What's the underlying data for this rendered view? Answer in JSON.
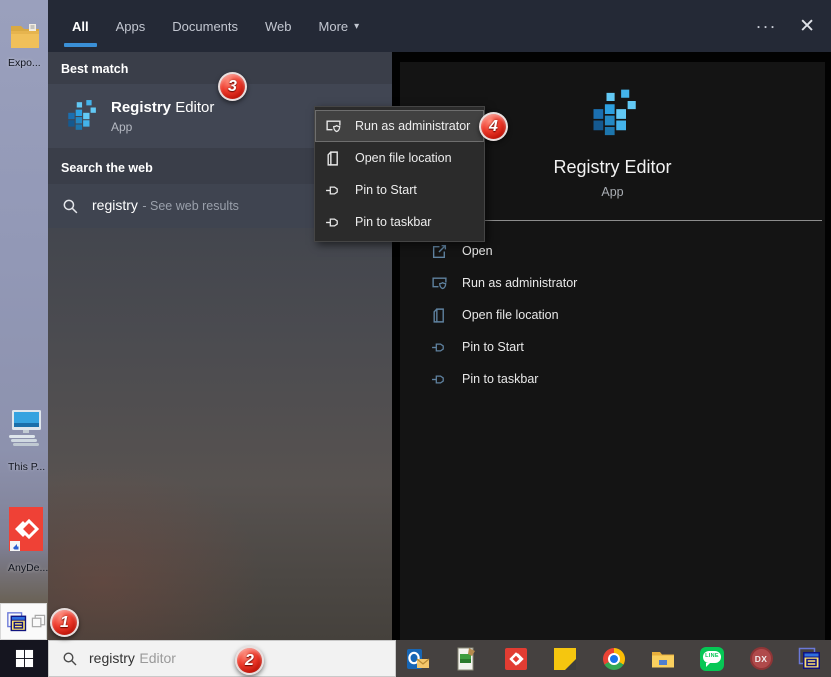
{
  "colors": {
    "accent_blue": "#3a8fd6",
    "topbar": "#242936",
    "left_panel": "#3a3e49",
    "row_highlight": "#414653",
    "right_panel": "#141414",
    "menu_bg": "#2b2b2b",
    "badge_red": "#d42a1e",
    "taskbar_tray": "#454140",
    "search_field": "#f2f2f2"
  },
  "glyphs": {
    "caret": "▾",
    "ellipsis": "∙∙∙",
    "close": "✕"
  },
  "tabs": {
    "items": [
      "All",
      "Apps",
      "Documents",
      "Web",
      "More"
    ]
  },
  "left_pane": {
    "best_match_header": "Best match",
    "best_match_title_bold": "Registry",
    "best_match_title_rest": " Editor",
    "best_match_subtitle": "App",
    "search_web_header": "Search the web",
    "web_query": "registry",
    "web_suffix": " - See web results"
  },
  "context_menu": {
    "items": [
      {
        "label": "Run as administrator",
        "icon": "run-as-admin-icon",
        "highlighted": true
      },
      {
        "label": "Open file location",
        "icon": "file-location-icon",
        "highlighted": false
      },
      {
        "label": "Pin to Start",
        "icon": "pin-icon",
        "highlighted": false
      },
      {
        "label": "Pin to taskbar",
        "icon": "pin-icon",
        "highlighted": false
      }
    ]
  },
  "right_pane": {
    "title": "Registry Editor",
    "subtitle": "App",
    "actions": [
      {
        "label": "Open",
        "icon": "open-launch-icon"
      },
      {
        "label": "Run as administrator",
        "icon": "run-as-admin-icon"
      },
      {
        "label": "Open file location",
        "icon": "file-location-icon"
      },
      {
        "label": "Pin to Start",
        "icon": "pin-icon"
      },
      {
        "label": "Pin to taskbar",
        "icon": "pin-icon"
      }
    ]
  },
  "taskbar": {
    "search_typed": "registry",
    "search_suggestion": "Editor",
    "line_label": "LINE",
    "dx_label": "DX",
    "tray_icons": [
      "outlook-icon",
      "photo-app-icon",
      "anydesk-red-icon",
      "sticky-notes-icon",
      "chrome-icon",
      "file-explorer-icon",
      "line-icon",
      "dx-icon",
      "regedit-window-icon"
    ]
  },
  "desktop": {
    "icons": [
      {
        "label": "Expo..."
      },
      {
        "label": "This P..."
      },
      {
        "label": "AnyDe..."
      }
    ]
  },
  "badges": [
    {
      "number": "1"
    },
    {
      "number": "2"
    },
    {
      "number": "3"
    },
    {
      "number": "4"
    }
  ]
}
